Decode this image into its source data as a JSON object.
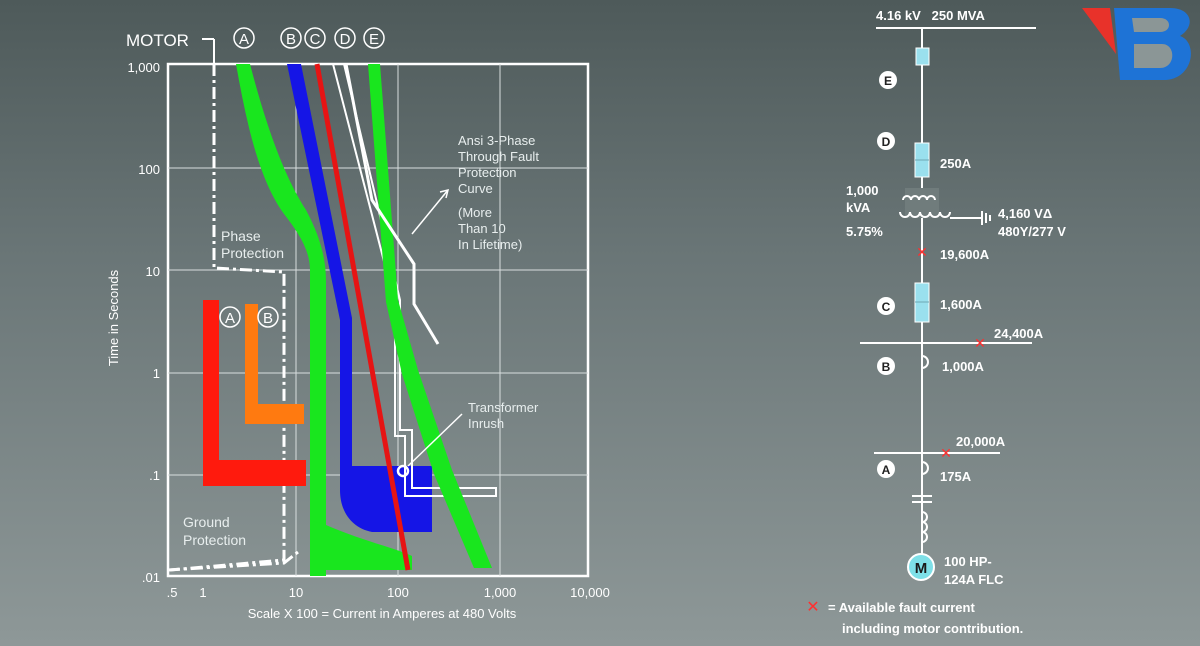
{
  "chart": {
    "motor_label": "MOTOR",
    "curve_letters": [
      "A",
      "B",
      "C",
      "D",
      "E"
    ],
    "y_ticks": [
      "1,000",
      "100",
      "10",
      "1",
      ".1",
      ".01"
    ],
    "x_ticks": [
      ".5",
      "1",
      "10",
      "100",
      "1,000",
      "10,000"
    ],
    "ylabel": "Time in Seconds",
    "xlabel": "Scale X 100 = Current in Amperes at 480 Volts",
    "annotations": {
      "ansi": [
        "Ansi 3-Phase",
        "Through Fault",
        "Protection",
        "Curve",
        "(More",
        "Than 10",
        "In Lifetime)"
      ],
      "phase": [
        "Phase",
        "Protection"
      ],
      "ground": [
        "Ground",
        "Protection"
      ],
      "inrush": [
        "Transformer",
        "Inrush"
      ],
      "relay_a": "A",
      "relay_b": "B"
    },
    "colors": {
      "A": "#19e61e",
      "B": "#1515e6",
      "C": "#e61414",
      "D": "#ffffff",
      "E": "#19e61e",
      "ground_relay": "#ff1a0d",
      "phase_relay": "#ff7a10"
    }
  },
  "oneline": {
    "source": "4.16 kV   250 MVA",
    "device_e": "E",
    "device_d": "D",
    "fuse_d": "250A",
    "xfmr": [
      "1,000",
      "kVA",
      "5.75%"
    ],
    "secondary": [
      "4,160 VΔ",
      "480Y/277 V"
    ],
    "fault_1": "19,600A",
    "device_c": "C",
    "fuse_c": "1,600A",
    "fault_2": "24,400A",
    "device_b": "B",
    "breaker_b": "1,000A",
    "fault_3": "20,000A",
    "device_a": "A",
    "breaker_a": "175A",
    "motor_symbol": "M",
    "motor_rating": [
      "100 HP-",
      "124A FLC"
    ],
    "legend_mark": "✕",
    "legend": [
      "= Available fault current",
      "including motor contribution."
    ]
  },
  "logo": {
    "text": "VB"
  }
}
